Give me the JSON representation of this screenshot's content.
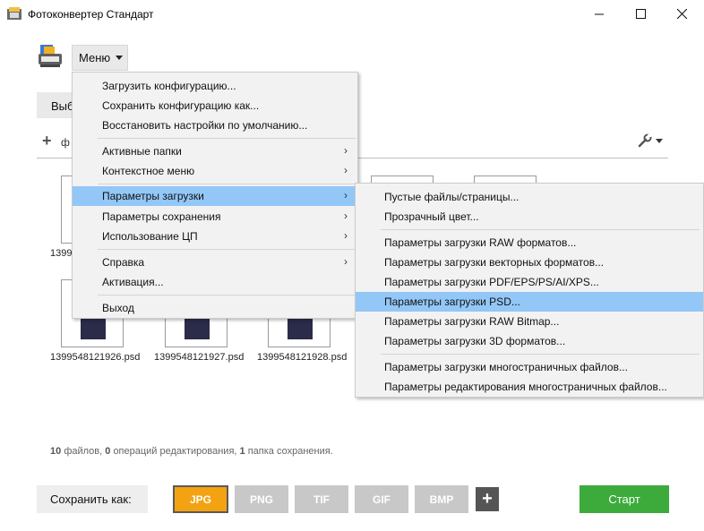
{
  "window": {
    "title": "Фотоконвертер Стандарт",
    "minimize_icon": "minimize-icon",
    "maximize_icon": "maximize-icon",
    "close_icon": "close-icon"
  },
  "toolbar": {
    "menu_label": "Меню",
    "select_label": "Выб",
    "add_label": "ф",
    "wrench_icon": "wrench-icon"
  },
  "main_menu": {
    "items": [
      {
        "label": "Загрузить конфигурацию...",
        "submenu": false
      },
      {
        "label": "Сохранить конфигурацию как...",
        "submenu": false
      },
      {
        "label": "Восстановить настройки по умолчанию...",
        "submenu": false
      },
      {
        "label": "Активные папки",
        "submenu": true
      },
      {
        "label": "Контекстное меню",
        "submenu": true
      },
      {
        "label": "Параметры загрузки",
        "submenu": true,
        "highlighted": true
      },
      {
        "label": "Параметры сохранения",
        "submenu": true
      },
      {
        "label": "Использование ЦП",
        "submenu": true
      },
      {
        "label": "Справка",
        "submenu": true
      },
      {
        "label": "Активация...",
        "submenu": false
      },
      {
        "label": "Выход",
        "submenu": false
      }
    ]
  },
  "load_submenu": {
    "items": [
      {
        "label": "Пустые файлы/страницы..."
      },
      {
        "label": "Прозрачный цвет..."
      },
      {
        "label": "Параметры загрузки RAW форматов..."
      },
      {
        "label": "Параметры загрузки векторных форматов..."
      },
      {
        "label": "Параметры загрузки PDF/EPS/PS/AI/XPS..."
      },
      {
        "label": "Параметры загрузки PSD...",
        "highlighted": true
      },
      {
        "label": "Параметры загрузки RAW Bitmap..."
      },
      {
        "label": "Параметры загрузки 3D форматов..."
      },
      {
        "label": "Параметры загрузки многостраничных файлов..."
      },
      {
        "label": "Параметры редактирования многостраничных файлов..."
      }
    ]
  },
  "files": {
    "row1_partial_label": "1399",
    "row2": [
      {
        "name": "1399548121926.psd"
      },
      {
        "name": "1399548121927.psd"
      },
      {
        "name": "1399548121928.psd"
      }
    ]
  },
  "status": {
    "files_count": "10",
    "files_text": "файлов,",
    "ops_count": "0",
    "ops_text": "операций редактирования,",
    "folders_count": "1",
    "folders_text": "папка сохранения."
  },
  "bottom": {
    "save_as_label": "Сохранить как:",
    "formats": [
      "JPG",
      "PNG",
      "TIF",
      "GIF",
      "BMP"
    ],
    "active_format": "JPG",
    "add_format_label": "+",
    "start_label": "Старт"
  },
  "colors": {
    "menu_highlight": "#93c7f7",
    "active_format": "#f3a212",
    "start_button": "#3cab3c"
  }
}
